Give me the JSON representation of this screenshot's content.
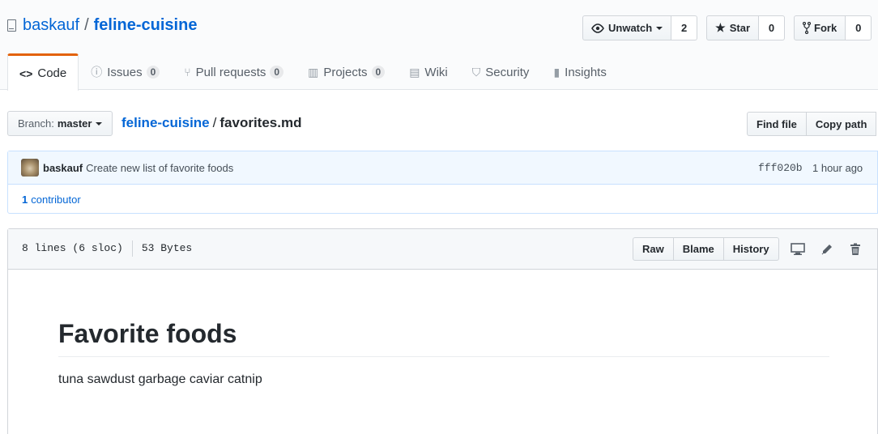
{
  "repo": {
    "owner": "baskauf",
    "name": "feline-cuisine"
  },
  "actions": {
    "watch": {
      "label": "Unwatch",
      "count": "2"
    },
    "star": {
      "label": "Star",
      "count": "0"
    },
    "fork": {
      "label": "Fork",
      "count": "0"
    }
  },
  "tabs": [
    {
      "label": "Code",
      "icon": "code-icon"
    },
    {
      "label": "Issues",
      "count": "0",
      "icon": "issue-icon"
    },
    {
      "label": "Pull requests",
      "count": "0",
      "icon": "pull-request-icon"
    },
    {
      "label": "Projects",
      "count": "0",
      "icon": "project-icon"
    },
    {
      "label": "Wiki",
      "icon": "book-icon"
    },
    {
      "label": "Security",
      "icon": "shield-icon"
    },
    {
      "label": "Insights",
      "icon": "graph-icon"
    }
  ],
  "filenav": {
    "branch_prefix": "Branch:",
    "branch": "master",
    "crumb_repo": "feline-cuisine",
    "crumb_sep": "/",
    "file": "favorites.md",
    "find_file": "Find file",
    "copy_path": "Copy path"
  },
  "commit": {
    "author": "baskauf",
    "message": "Create new list of favorite foods",
    "sha": "fff020b",
    "time": "1 hour ago",
    "contributors_count": "1",
    "contributors_label": "contributor"
  },
  "file": {
    "lines": "8 lines (6 sloc)",
    "size": "53 Bytes",
    "raw": "Raw",
    "blame": "Blame",
    "history": "History"
  },
  "content": {
    "heading": "Favorite foods",
    "body": "tuna sawdust garbage caviar catnip"
  },
  "colors": {
    "link": "#0366d6",
    "tab_accent": "#e36209"
  }
}
